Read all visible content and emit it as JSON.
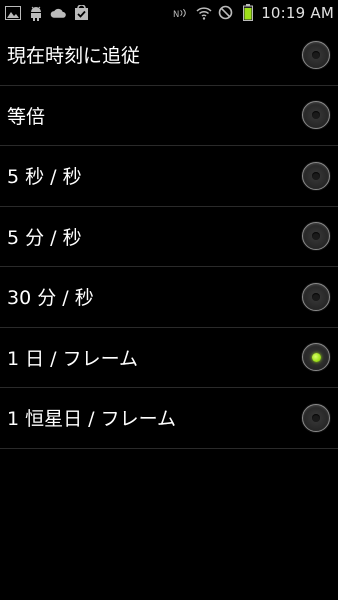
{
  "status_bar": {
    "time": "10:19 AM",
    "left_icons": [
      "gallery-icon",
      "android-icon",
      "cloud-icon",
      "check-bag-icon"
    ],
    "right_icons": [
      "nfc-icon",
      "wifi-icon",
      "no-signal-icon",
      "battery-icon"
    ],
    "battery_color": "#9ee01a"
  },
  "options": [
    {
      "label": "現在時刻に追従",
      "selected": false
    },
    {
      "label": "等倍",
      "selected": false
    },
    {
      "label": "5 秒 / 秒",
      "selected": false
    },
    {
      "label": "5 分 / 秒",
      "selected": false
    },
    {
      "label": "30 分 / 秒",
      "selected": false
    },
    {
      "label": "1 日 / フレーム",
      "selected": true
    },
    {
      "label": "1 恒星日 / フレーム",
      "selected": false
    }
  ],
  "colors": {
    "background": "#000000",
    "divider": "#2a2a2a",
    "selected_accent": "#9ee01a"
  }
}
